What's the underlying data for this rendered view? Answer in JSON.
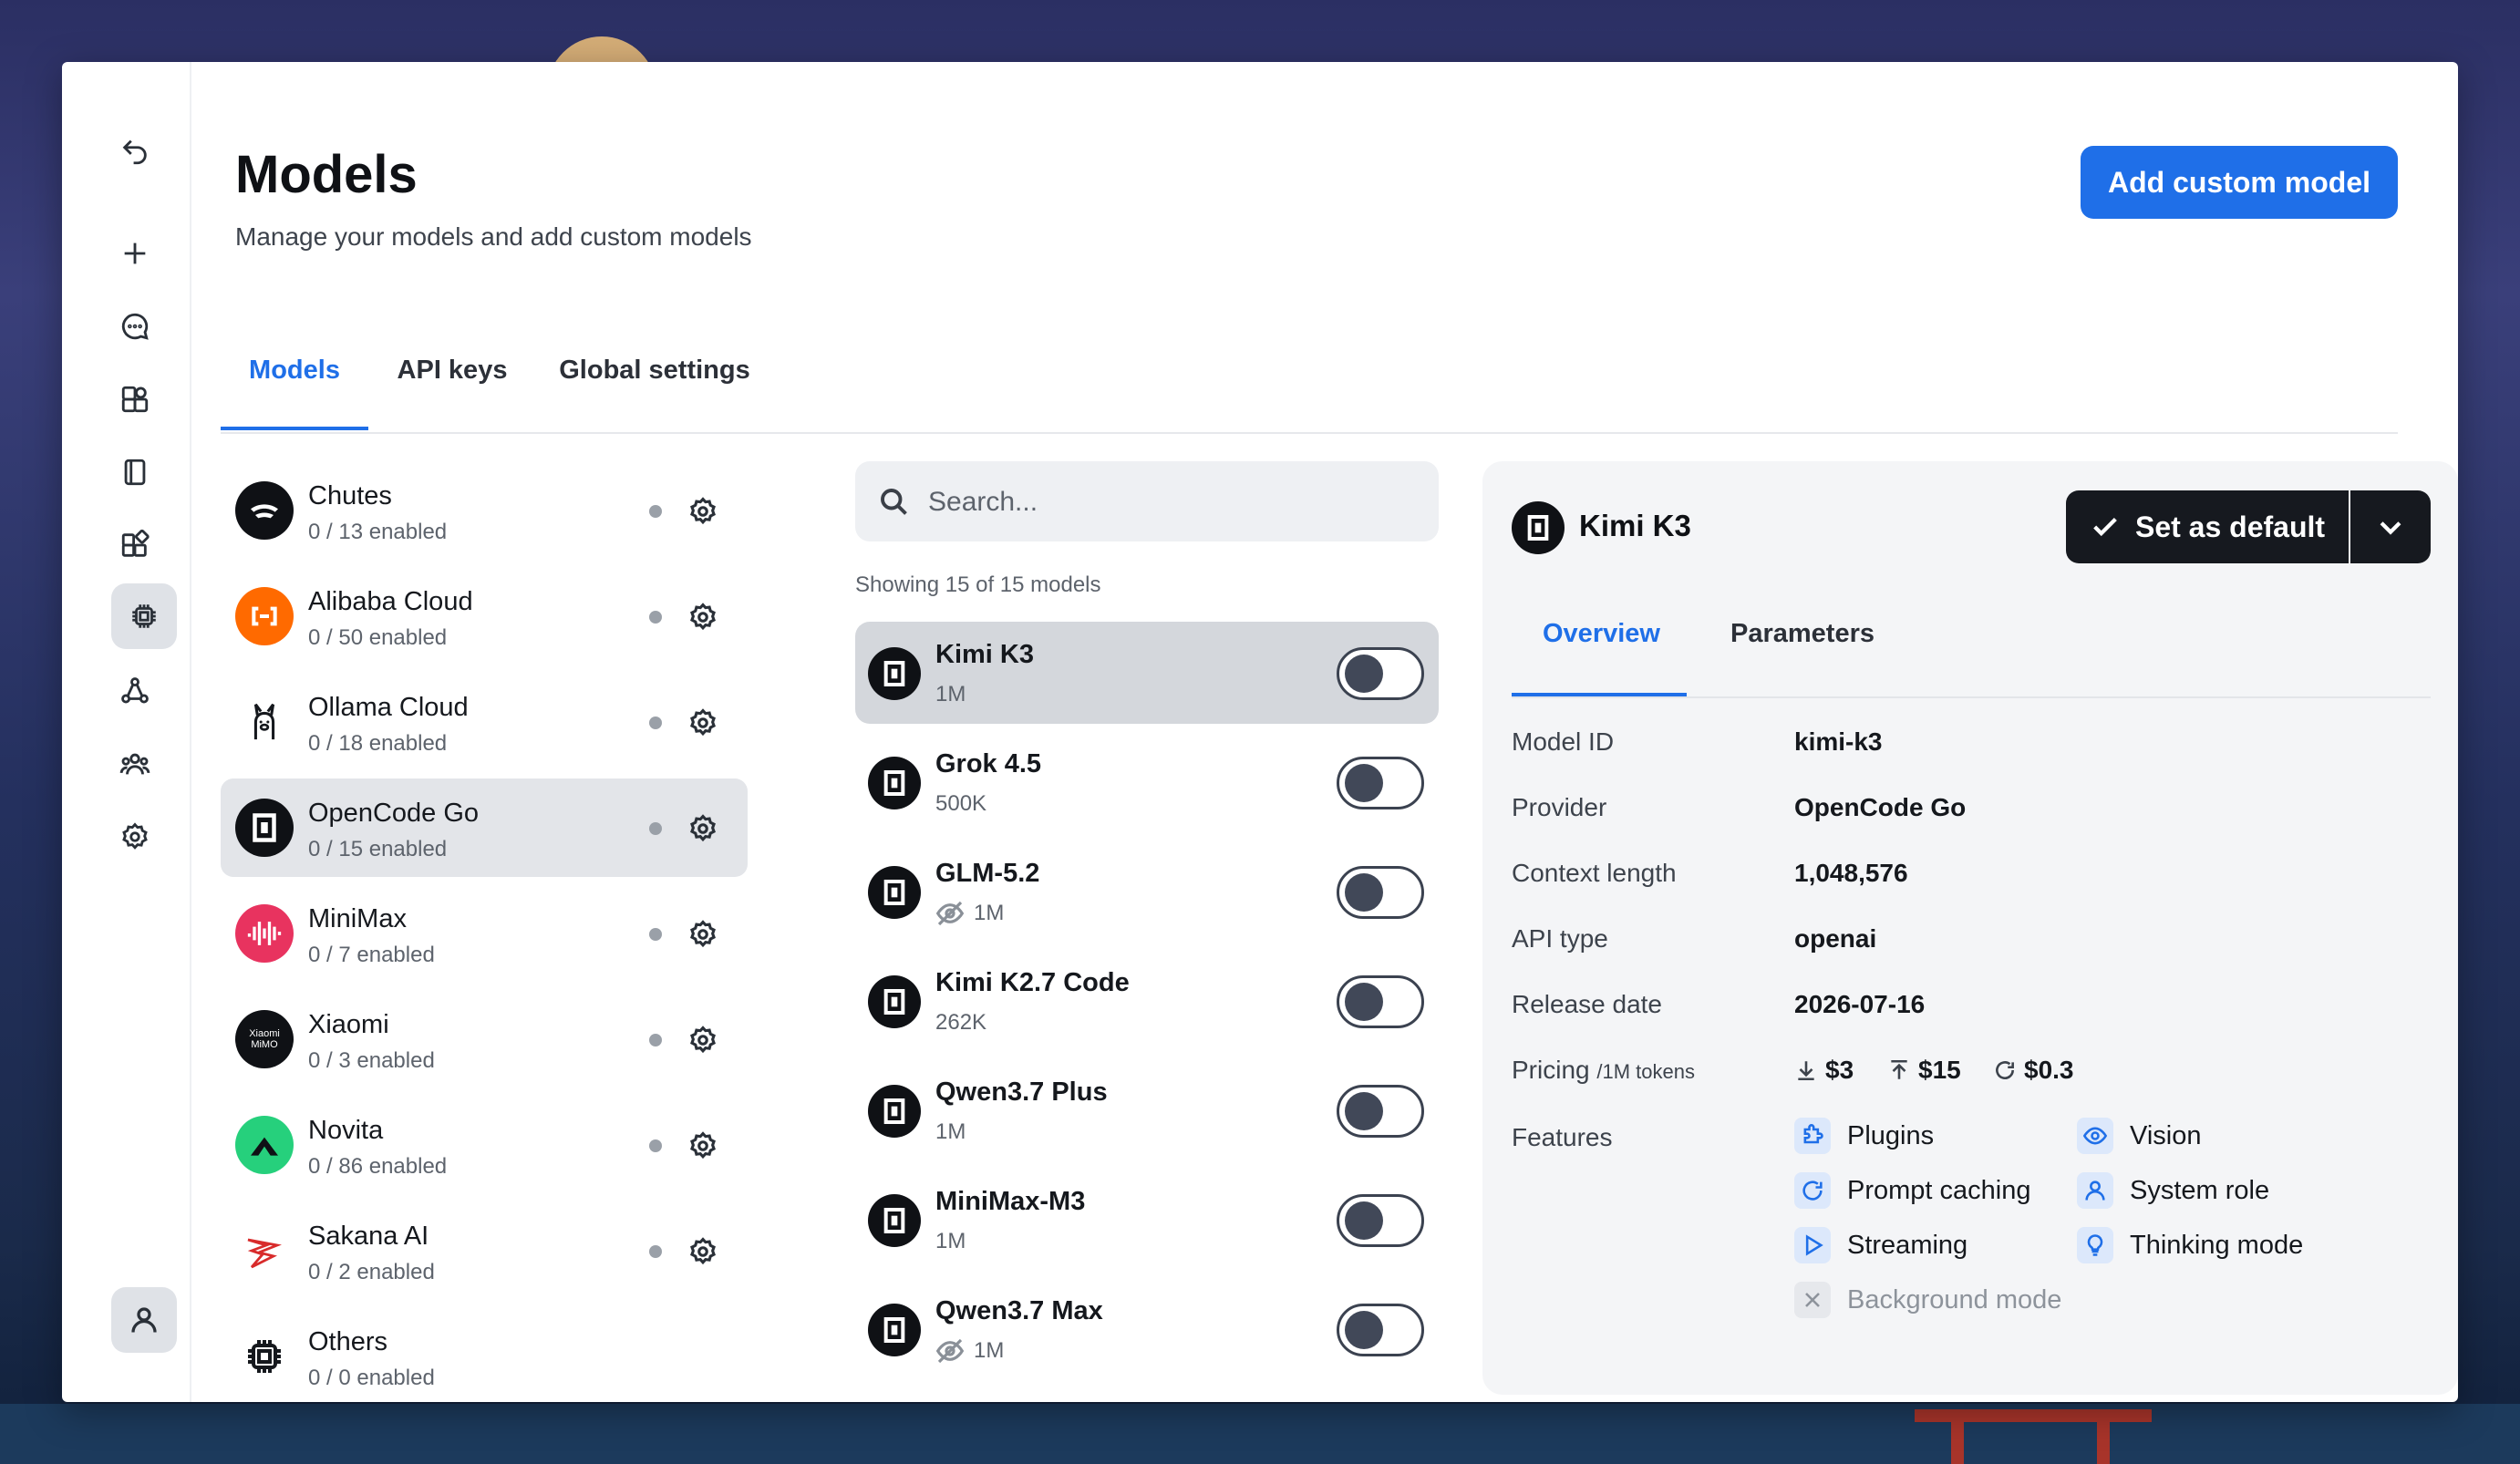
{
  "header": {
    "title": "Models",
    "subtitle": "Manage your models and add custom models",
    "add_button": "Add custom model"
  },
  "tabs": [
    {
      "label": "Models",
      "active": true
    },
    {
      "label": "API keys",
      "active": false
    },
    {
      "label": "Global settings",
      "active": false
    }
  ],
  "rail": {
    "items": [
      "back-icon",
      "plus-icon",
      "chat-icon",
      "apps-icon",
      "book-icon",
      "extensions-icon",
      "chip-icon",
      "share-icon",
      "team-icon",
      "settings-icon"
    ],
    "active": "chip-icon",
    "user": "user-icon"
  },
  "providers": [
    {
      "name": "Chutes",
      "count": "0 / 13 enabled",
      "color": "#0f1115"
    },
    {
      "name": "Alibaba Cloud",
      "count": "0 / 50 enabled",
      "color": "#ff6a00"
    },
    {
      "name": "Ollama Cloud",
      "count": "0 / 18 enabled",
      "color": "#ffffff"
    },
    {
      "name": "OpenCode Go",
      "count": "0 / 15 enabled",
      "color": "#0f1115",
      "selected": true
    },
    {
      "name": "MiniMax",
      "count": "0 / 7 enabled",
      "color": "#e8335f"
    },
    {
      "name": "Xiaomi",
      "count": "0 / 3 enabled",
      "color": "#0f1115",
      "logo_text": "Xiaomi MiMO"
    },
    {
      "name": "Novita",
      "count": "0 / 86 enabled",
      "color": "#26d07c"
    },
    {
      "name": "Sakana AI",
      "count": "0 / 2 enabled",
      "color": "#ffffff"
    },
    {
      "name": "Others",
      "count": "0 / 0 enabled",
      "color": "#ffffff"
    }
  ],
  "search": {
    "placeholder": "Search...",
    "showing": "Showing 15 of 15 models"
  },
  "models": [
    {
      "name": "Kimi K3",
      "context": "1M",
      "hidden": false,
      "enabled": false,
      "selected": true
    },
    {
      "name": "Grok 4.5",
      "context": "500K",
      "hidden": false,
      "enabled": false
    },
    {
      "name": "GLM-5.2",
      "context": "1M",
      "hidden": true,
      "enabled": false
    },
    {
      "name": "Kimi K2.7 Code",
      "context": "262K",
      "hidden": false,
      "enabled": false
    },
    {
      "name": "Qwen3.7 Plus",
      "context": "1M",
      "hidden": false,
      "enabled": false
    },
    {
      "name": "MiniMax-M3",
      "context": "1M",
      "hidden": false,
      "enabled": false
    },
    {
      "name": "Qwen3.7 Max",
      "context": "1M",
      "hidden": true,
      "enabled": false
    }
  ],
  "detail": {
    "name": "Kimi K3",
    "set_default": "Set as default",
    "tabs": [
      "Overview",
      "Parameters"
    ],
    "fields": {
      "model_id_label": "Model ID",
      "model_id": "kimi-k3",
      "provider_label": "Provider",
      "provider": "OpenCode Go",
      "context_label": "Context length",
      "context": "1,048,576",
      "api_type_label": "API type",
      "api_type": "openai",
      "release_label": "Release date",
      "release": "2026-07-16",
      "pricing_label": "Pricing",
      "pricing_unit": "/1M tokens",
      "price_input": "$3",
      "price_output": "$15",
      "price_cache": "$0.3",
      "features_label": "Features"
    },
    "features": [
      {
        "label": "Plugins",
        "icon": "puzzle-icon",
        "enabled": true
      },
      {
        "label": "Vision",
        "icon": "eye-icon",
        "enabled": true
      },
      {
        "label": "Prompt caching",
        "icon": "refresh-icon",
        "enabled": true
      },
      {
        "label": "System role",
        "icon": "person-icon",
        "enabled": true
      },
      {
        "label": "Streaming",
        "icon": "play-icon",
        "enabled": true
      },
      {
        "label": "Thinking mode",
        "icon": "lightbulb-icon",
        "enabled": true
      },
      {
        "label": "Background mode",
        "icon": "x-icon",
        "enabled": false
      }
    ]
  },
  "colors": {
    "accent": "#1f6fe8",
    "dark": "#16191f"
  }
}
